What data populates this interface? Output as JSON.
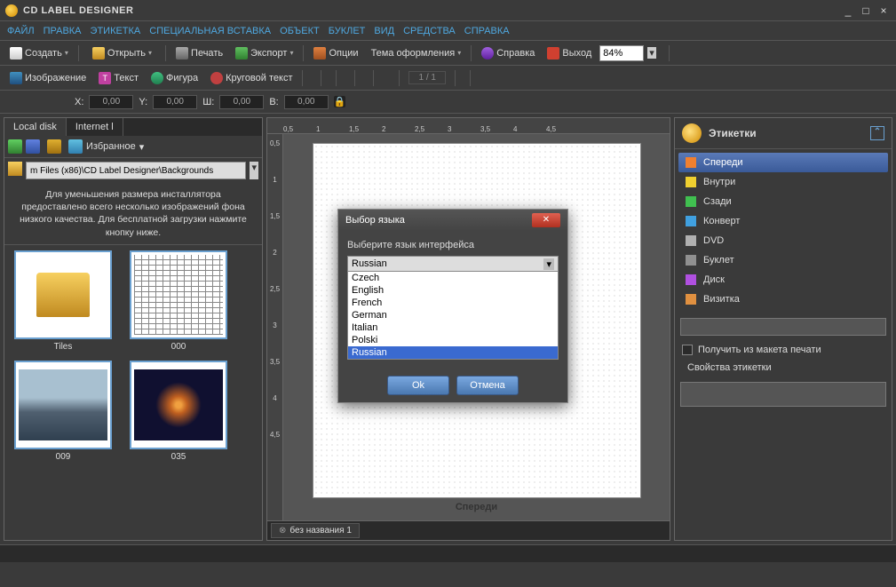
{
  "app": {
    "title": "CD LABEL DESIGNER"
  },
  "menu": [
    "ФАЙЛ",
    "ПРАВКА",
    "ЭТИКЕТКА",
    "СПЕЦИАЛЬНАЯ ВСТАВКА",
    "ОБЪЕКТ",
    "БУКЛЕТ",
    "ВИД",
    "СРЕДСТВА",
    "СПРАВКА"
  ],
  "toolbar1": {
    "create": "Создать",
    "open": "Открыть",
    "print": "Печать",
    "export": "Экспорт",
    "options": "Опции",
    "theme": "Тема оформления",
    "help": "Справка",
    "exit": "Выход",
    "zoom": "84%"
  },
  "toolbar2": {
    "image": "Изображение",
    "text": "Текст",
    "shape": "Фигура",
    "circtext": "Круговой текст",
    "page_indicator": "1 / 1"
  },
  "coords": {
    "x_label": "X:",
    "x": "0,00",
    "y_label": "Y:",
    "y": "0,00",
    "w_label": "Ш:",
    "w": "0,00",
    "h_label": "В:",
    "h": "0,00"
  },
  "ruler_h": [
    "0,5",
    "1",
    "1,5",
    "2",
    "2,5",
    "3",
    "3,5",
    "4",
    "4,5"
  ],
  "ruler_v": [
    "0,5",
    "1",
    "1,5",
    "2",
    "2,5",
    "3",
    "3,5",
    "4",
    "4,5"
  ],
  "left": {
    "tabs": [
      "Local disk",
      "Internet l"
    ],
    "fav": "Избранное",
    "path": "m Files (x86)\\CD Label Designer\\Backgrounds",
    "info": "Для уменьшения размера инсталлятора предоставлено всего несколько изображений фона низкого качества. Для бесплатной загрузки нажмите кнопку ниже.",
    "thumbs": [
      {
        "name": "Tiles",
        "kind": "folder"
      },
      {
        "name": "000",
        "kind": "grid"
      },
      {
        "name": "009",
        "kind": "sea"
      },
      {
        "name": "035",
        "kind": "fire"
      }
    ]
  },
  "canvas": {
    "page_label": "Спереди",
    "doc_tab": "без названия 1"
  },
  "right": {
    "title": "Этикетки",
    "items": [
      {
        "label": "Спереди",
        "color": "#f08030",
        "active": true
      },
      {
        "label": "Внутри",
        "color": "#f0d030"
      },
      {
        "label": "Сзади",
        "color": "#40c050"
      },
      {
        "label": "Конверт",
        "color": "#40a0e0"
      },
      {
        "label": "DVD",
        "color": "#b0b0b0"
      },
      {
        "label": "Буклет",
        "color": "#909090"
      },
      {
        "label": "Диск",
        "color": "#b050e0"
      },
      {
        "label": "Визитка",
        "color": "#e09040"
      }
    ],
    "get_from_print": "Получить из макета печати",
    "props": "Свойства этикетки"
  },
  "dialog": {
    "title": "Выбор языка",
    "prompt": "Выберите язык интерфейса",
    "selected": "Russian",
    "options": [
      "Czech",
      "English",
      "French",
      "German",
      "Italian",
      "Polski",
      "Russian"
    ],
    "ok": "Ok",
    "cancel": "Отмена"
  }
}
